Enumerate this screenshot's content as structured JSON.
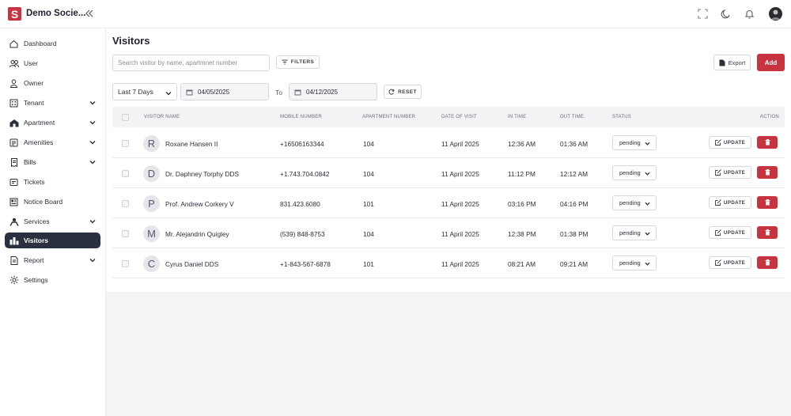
{
  "app": {
    "logo_letter": "S",
    "brand": "Demo Socie..."
  },
  "sidebar": {
    "items": [
      {
        "label": "Dashboard",
        "icon": "home-icon",
        "expandable": false,
        "active": false
      },
      {
        "label": "User",
        "icon": "users-icon",
        "expandable": false,
        "active": false
      },
      {
        "label": "Owner",
        "icon": "owner-icon",
        "expandable": false,
        "active": false
      },
      {
        "label": "Tenant",
        "icon": "tenant-icon",
        "expandable": true,
        "active": false
      },
      {
        "label": "Apartment",
        "icon": "apartment-icon",
        "expandable": true,
        "active": false
      },
      {
        "label": "Amenities",
        "icon": "amenities-icon",
        "expandable": true,
        "active": false
      },
      {
        "label": "Bills",
        "icon": "bills-icon",
        "expandable": true,
        "active": false
      },
      {
        "label": "Tickets",
        "icon": "tickets-icon",
        "expandable": false,
        "active": false
      },
      {
        "label": "Notice Board",
        "icon": "notice-board-icon",
        "expandable": false,
        "active": false
      },
      {
        "label": "Services",
        "icon": "services-icon",
        "expandable": true,
        "active": false
      },
      {
        "label": "Visitors",
        "icon": "visitors-icon",
        "expandable": false,
        "active": true
      },
      {
        "label": "Report",
        "icon": "report-icon",
        "expandable": true,
        "active": false
      },
      {
        "label": "Settings",
        "icon": "settings-icon",
        "expandable": false,
        "active": false
      }
    ]
  },
  "page": {
    "title": "Visitors"
  },
  "toolbar": {
    "search_placeholder": "Search visitor by name, apartmnet number",
    "filters_label": "FILTERS",
    "export_label": "Export",
    "add_label": "Add"
  },
  "filters": {
    "range": "Last 7 Days",
    "from_date": "04/05/2025",
    "to_label": "To",
    "to_date": "04/12/2025",
    "reset_label": "RESET"
  },
  "table": {
    "headers": {
      "name": "VISITOR NAME",
      "mobile": "MOBILE NUMBER",
      "apartment": "APARTMENT NUMBER",
      "date": "DATE OF VISIT",
      "in": "IN TIME",
      "out": "OUT TIME",
      "status": "STATUS",
      "action": "ACTION"
    },
    "update_label": "UPDATE",
    "rows": [
      {
        "initial": "R",
        "name": "Roxane Hansen II",
        "mobile": "+16506163344",
        "apartment": "104",
        "date": "11 April 2025",
        "in": "12:36 AM",
        "out": "01:36 AM",
        "status": "pending"
      },
      {
        "initial": "D",
        "name": "Dr. Daphney Torphy DDS",
        "mobile": "+1.743.704.0842",
        "apartment": "104",
        "date": "11 April 2025",
        "in": "11:12 PM",
        "out": "12:12 AM",
        "status": "pending"
      },
      {
        "initial": "P",
        "name": "Prof. Andrew Corkery V",
        "mobile": "831.423.6080",
        "apartment": "101",
        "date": "11 April 2025",
        "in": "03:16 PM",
        "out": "04:16 PM",
        "status": "pending"
      },
      {
        "initial": "M",
        "name": "Mr. Alejandrin Quigley",
        "mobile": "(539) 848-8753",
        "apartment": "104",
        "date": "11 April 2025",
        "in": "12:38 PM",
        "out": "01:38 PM",
        "status": "pending"
      },
      {
        "initial": "C",
        "name": "Cyrus Daniel DDS",
        "mobile": "+1-843-567-6878",
        "apartment": "101",
        "date": "11 April 2025",
        "in": "08:21 AM",
        "out": "09:21 AM",
        "status": "pending"
      }
    ]
  },
  "colors": {
    "accent": "#c7333e",
    "active_nav": "#2b3040"
  }
}
